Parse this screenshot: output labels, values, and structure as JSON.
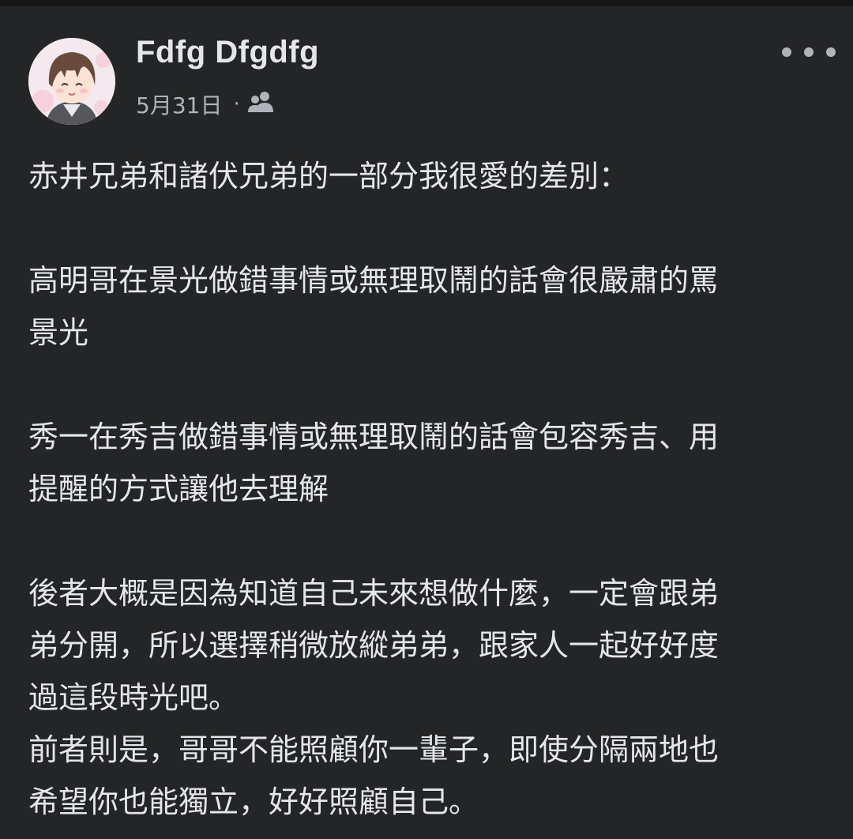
{
  "post": {
    "author": "Fdfg Dfgdfg",
    "date": "5月31日",
    "separator": "·",
    "audience_icon": "friends-icon",
    "more_icon": "more-icon",
    "lines": [
      "赤井兄弟和諸伏兄弟的一部分我很愛的差別：",
      "高明哥在景光做錯事情或無理取鬧的話會很嚴肅的罵",
      "景光",
      "秀一在秀吉做錯事情或無理取鬧的話會包容秀吉、用",
      "提醒的方式讓他去理解",
      "後者大概是因為知道自己未來想做什麼，一定會跟弟",
      "弟分開，所以選擇稍微放縱弟弟，跟家人一起好好度",
      "過這段時光吧。",
      "前者則是，哥哥不能照顧你一輩子，即使分隔兩地也",
      "希望你也能獨立，好好照顧自己。"
    ]
  },
  "colors": {
    "background": "#242526",
    "text": "#e4e6eb",
    "secondary_text": "#b0b3b8"
  }
}
